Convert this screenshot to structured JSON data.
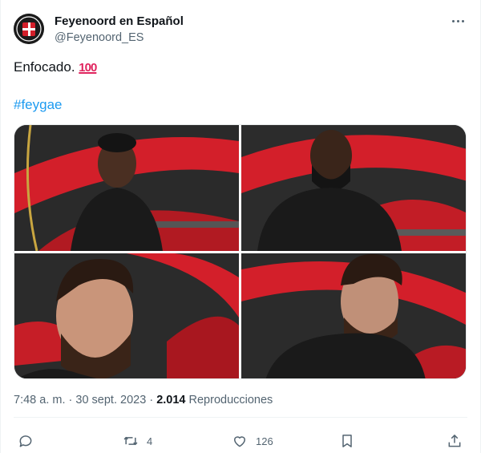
{
  "account": {
    "display_name": "Feyenoord en Español",
    "handle": "@Feyenoord_ES"
  },
  "tweet": {
    "text": "Enfocado.",
    "emoji": "100",
    "hashtag": "#feygae"
  },
  "meta": {
    "time": "7:48 a. m.",
    "separator": "·",
    "date": "30 sept. 2023",
    "views_count": "2.014",
    "views_label": "Reproducciones"
  },
  "actions": {
    "retweets": "4",
    "likes": "126"
  },
  "colors": {
    "accent": "#1d9bf0",
    "text": "#0f1419",
    "secondary": "#536471",
    "emoji": "#e0245e",
    "background_red": "#d31f2a"
  },
  "icons": [
    "more-icon",
    "reply-icon",
    "retweet-icon",
    "like-icon",
    "bookmark-icon",
    "share-icon"
  ]
}
